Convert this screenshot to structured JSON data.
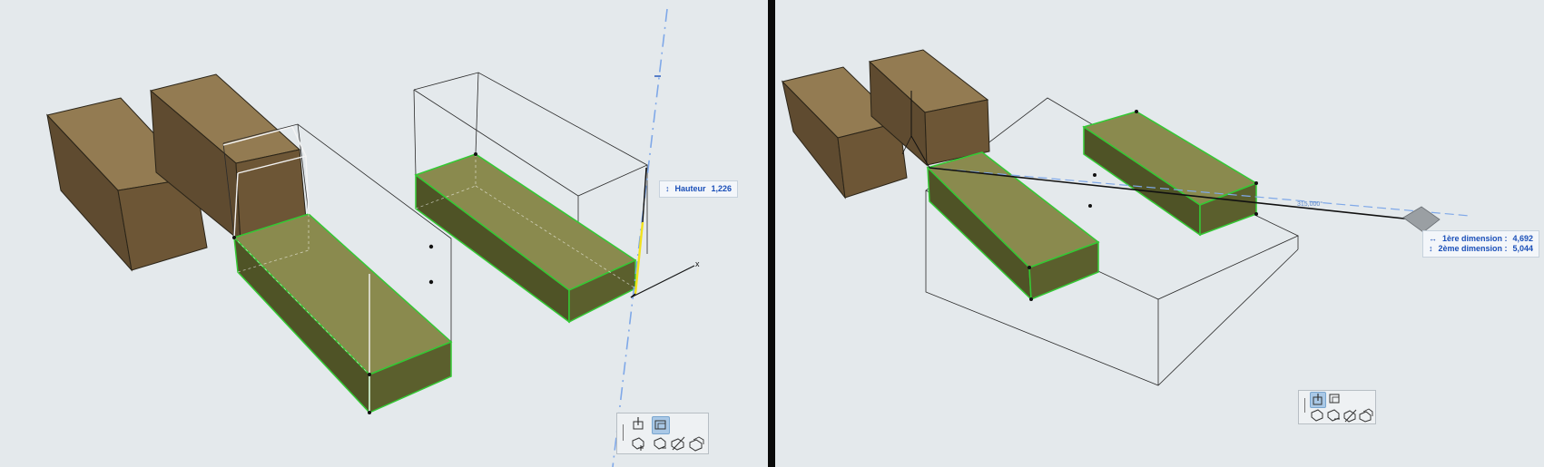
{
  "left_view": {
    "height_tooltip": {
      "icon": "vertical-arrow-icon",
      "label": "Hauteur",
      "value": "1,226"
    },
    "axis_label": "x"
  },
  "right_view": {
    "dimension_tooltip": {
      "first": {
        "icon": "horizontal-arrow-icon",
        "label": "1ère dimension :",
        "value": "4,692"
      },
      "second": {
        "icon": "vertical-arrow-icon",
        "label": "2ème dimension :",
        "value": "5,044"
      }
    },
    "angle_label": "315,000°"
  },
  "colors": {
    "background": "#e4e9ec",
    "brown_top": "#937b52",
    "brown_side": "#5f4b30",
    "green_top": "#8a8a4e",
    "green_side": "#4f5326",
    "selection_edge": "#34c934",
    "guide_line": "#7fa8e8",
    "tooltip_text": "#1a4fb8"
  },
  "palette_left": [
    "push-pull-icon",
    "offset-icon",
    "add-volume-icon",
    "subtract-volume-icon",
    "split-icon",
    "merge-icon"
  ],
  "palette_right": [
    "push-pull-icon",
    "offset-icon",
    "add-volume-icon",
    "subtract-volume-icon",
    "split-icon",
    "merge-icon"
  ]
}
